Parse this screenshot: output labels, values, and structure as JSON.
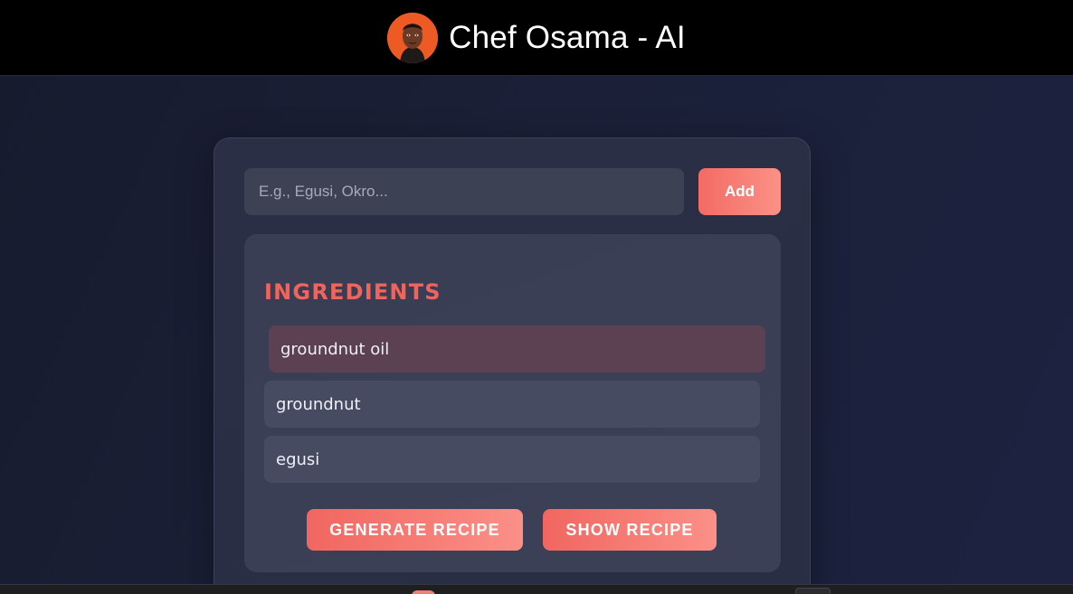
{
  "header": {
    "title": "Chef Osama - AI",
    "avatar_icon": "chef-avatar-icon"
  },
  "add_form": {
    "placeholder": "E.g., Egusi, Okro...",
    "value": "",
    "add_label": "Add"
  },
  "ingredients": {
    "heading": "INGREDIENTS",
    "items": [
      {
        "label": "groundnut oil",
        "active": true
      },
      {
        "label": "groundnut",
        "active": false
      },
      {
        "label": "egusi",
        "active": false
      }
    ]
  },
  "actions": {
    "generate_label": "GENERATE RECIPE",
    "show_label": "SHOW RECIPE"
  },
  "colors": {
    "accent": "#f36b64",
    "accent_light": "#fb9186",
    "topbar": "#000000",
    "background": "#1a1f35",
    "card": "#2b2f45",
    "panel": "#3a3e54",
    "item": "#474b61",
    "item_active": "#5b4151"
  }
}
